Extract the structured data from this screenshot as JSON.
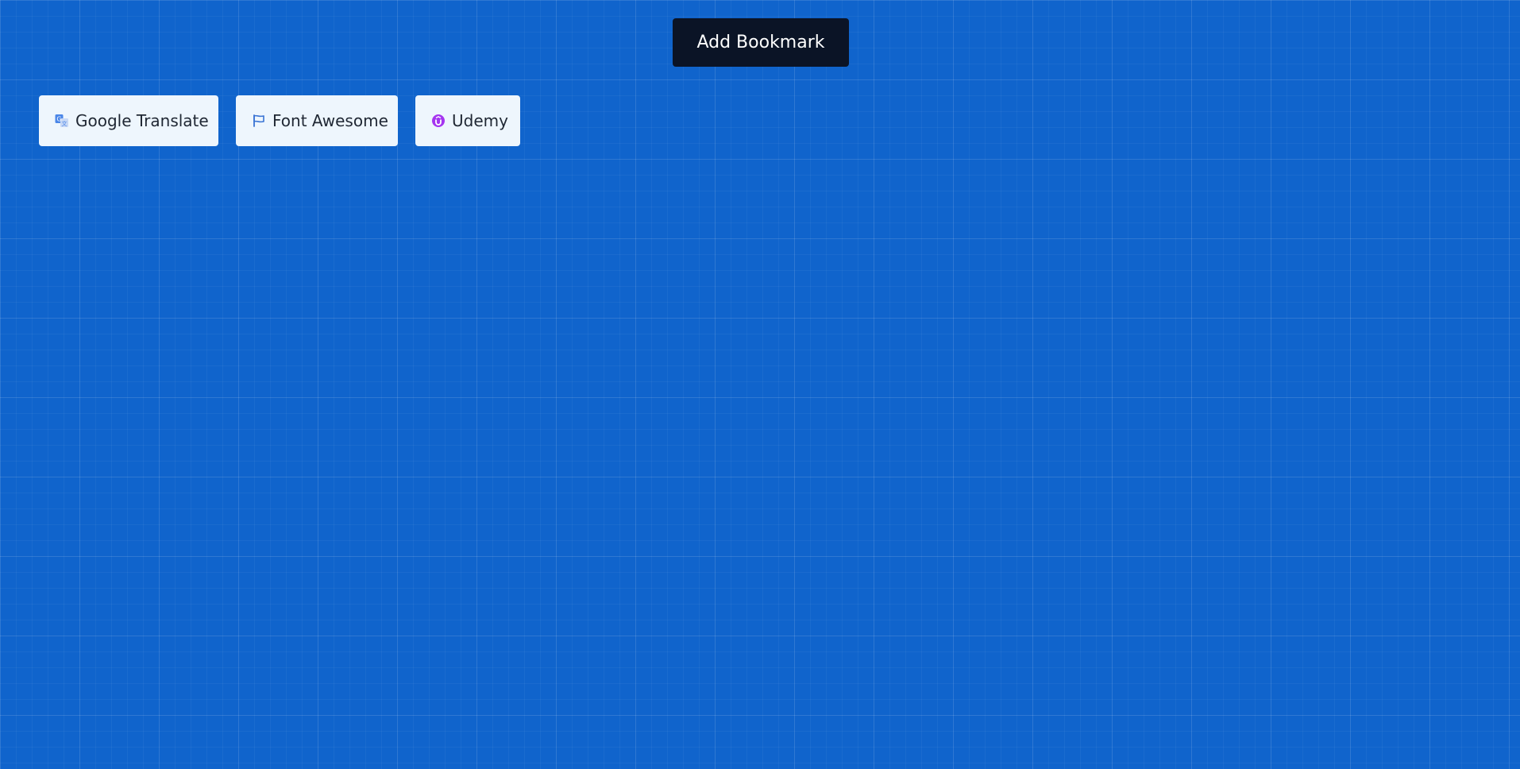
{
  "toolbar": {
    "add_bookmark_label": "Add Bookmark"
  },
  "bookmarks": [
    {
      "label": "Google Translate",
      "icon": "google-translate-icon",
      "icon_color": "#4a86e8"
    },
    {
      "label": "Font Awesome",
      "icon": "flag-icon",
      "icon_color": "#3a74d4"
    },
    {
      "label": "Udemy",
      "icon": "udemy-icon",
      "icon_color": "#a435f0"
    }
  ],
  "colors": {
    "background": "#1064cc",
    "button_bg": "#0b1426",
    "bookmark_bg": "#eef6fd",
    "text": "#1f2733"
  }
}
